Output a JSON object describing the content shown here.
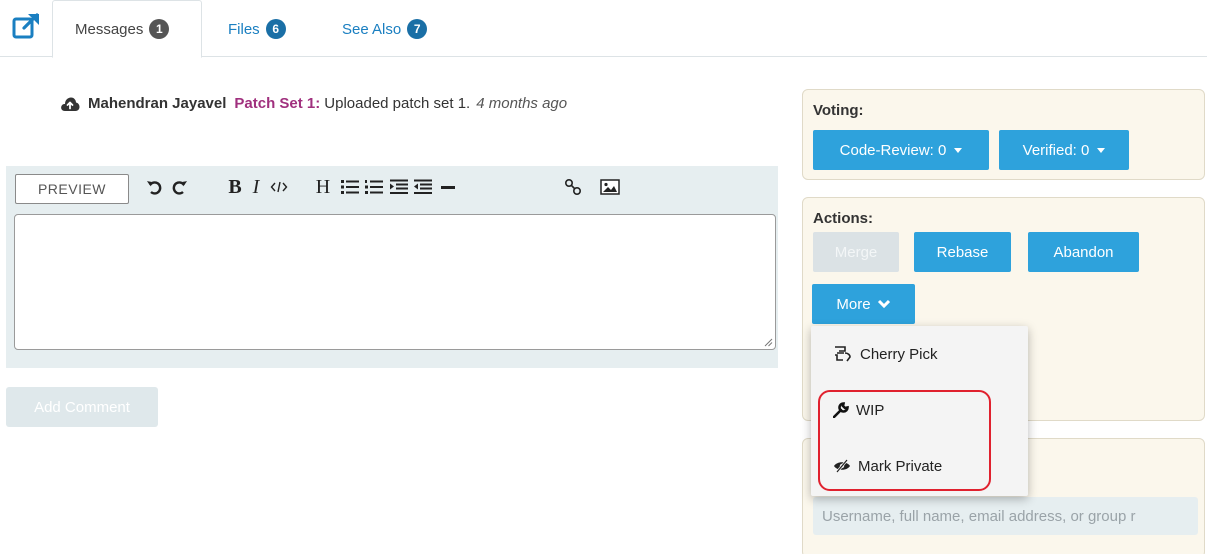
{
  "tabs": [
    {
      "label": "Messages",
      "count": "1"
    },
    {
      "label": "Files",
      "count": "6"
    },
    {
      "label": "See Also",
      "count": "7"
    }
  ],
  "message": {
    "author": "Mahendran Jayavel",
    "patchset": "Patch Set 1:",
    "text": "Uploaded patch set 1.",
    "time": "4 months ago"
  },
  "editor": {
    "preview_label": "PREVIEW",
    "add_comment_label": "Add Comment"
  },
  "voting": {
    "title": "Voting:",
    "code_review": "Code-Review: 0",
    "verified": "Verified: 0"
  },
  "actions": {
    "title": "Actions:",
    "merge": "Merge",
    "rebase": "Rebase",
    "abandon": "Abandon",
    "more": "More",
    "menu": [
      {
        "label": "Cherry Pick",
        "icon": "cherry-pick-icon"
      },
      {
        "label": "WIP",
        "icon": "wrench-icon"
      },
      {
        "label": "Mark Private",
        "icon": "eye-slash-icon"
      }
    ]
  },
  "reviewers": {
    "placeholder": "Username, full name, email address, or group r"
  },
  "colors": {
    "accent": "#2ea2dc",
    "link": "#1a7fc1",
    "patchset": "#a0307e",
    "panel_bg": "#fbf7ec",
    "highlight": "#e0212e"
  }
}
